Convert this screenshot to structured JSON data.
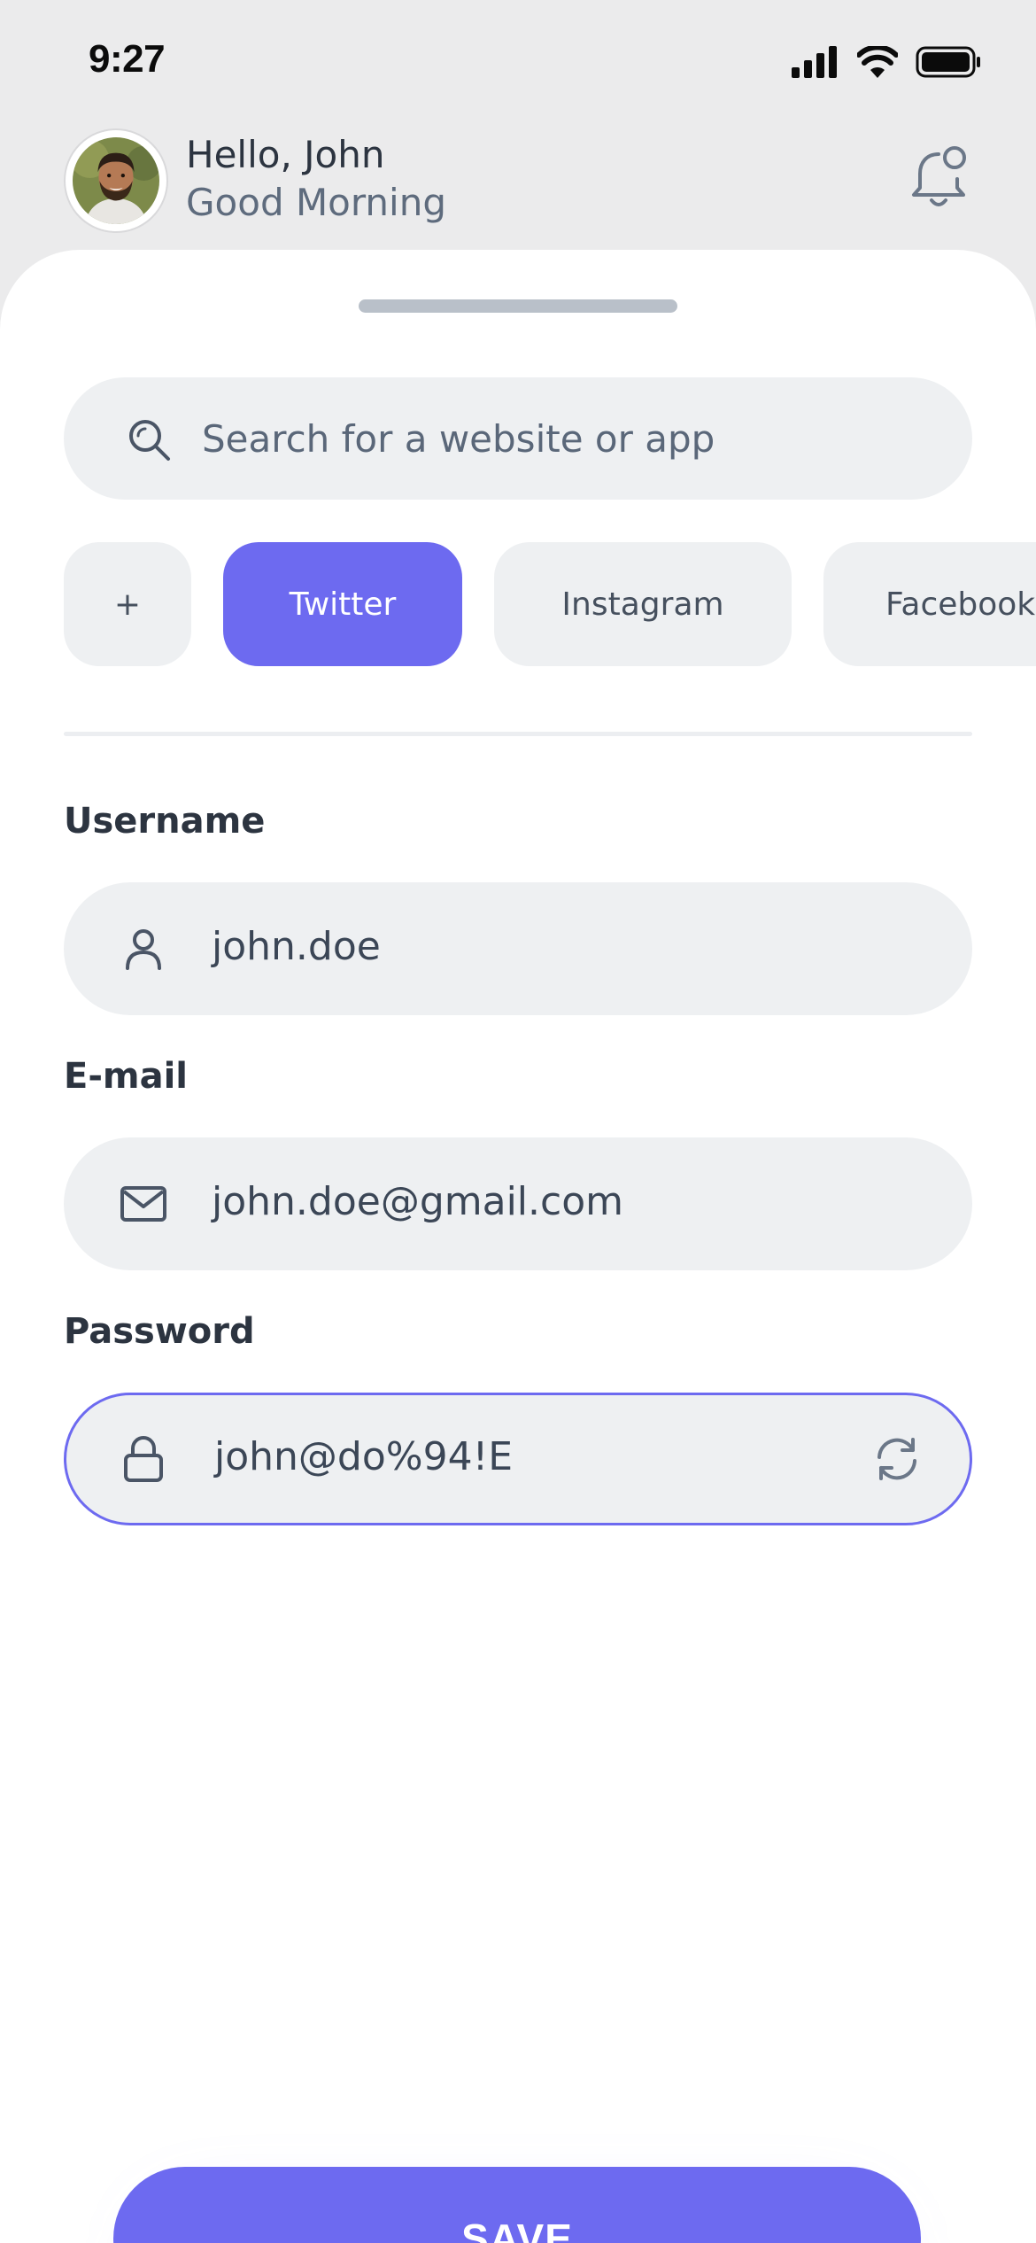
{
  "status_bar": {
    "time": "9:27",
    "icons": [
      "cellular-signal-icon",
      "wifi-icon",
      "battery-icon"
    ]
  },
  "header": {
    "greeting_name": "Hello, John",
    "greeting_sub": "Good Morning",
    "icons": [
      "avatar-photo",
      "bell-icon"
    ]
  },
  "search": {
    "placeholder": "Search for a website or app",
    "icon": "search-icon"
  },
  "chips": {
    "add_label": "+",
    "items": [
      {
        "label": "Twitter",
        "active": true
      },
      {
        "label": "Instagram",
        "active": false
      },
      {
        "label": "Facebook",
        "active": false
      }
    ]
  },
  "form": {
    "username": {
      "label": "Username",
      "value": "john.doe",
      "icon": "user-icon"
    },
    "email": {
      "label": "E-mail",
      "value": "john.doe@gmail.com",
      "icon": "mail-icon"
    },
    "password": {
      "label": "Password",
      "value": "john@do%94!E",
      "icon": "lock-icon",
      "action_icon": "refresh-icon",
      "focused": true
    }
  },
  "save_label": "SAVE",
  "colors": {
    "accent": "#6d6af0",
    "background": "#ebebec",
    "sheet": "#ffffff",
    "field": "#eef0f2",
    "text": "#2c3440",
    "muted": "#5e6b7d"
  }
}
